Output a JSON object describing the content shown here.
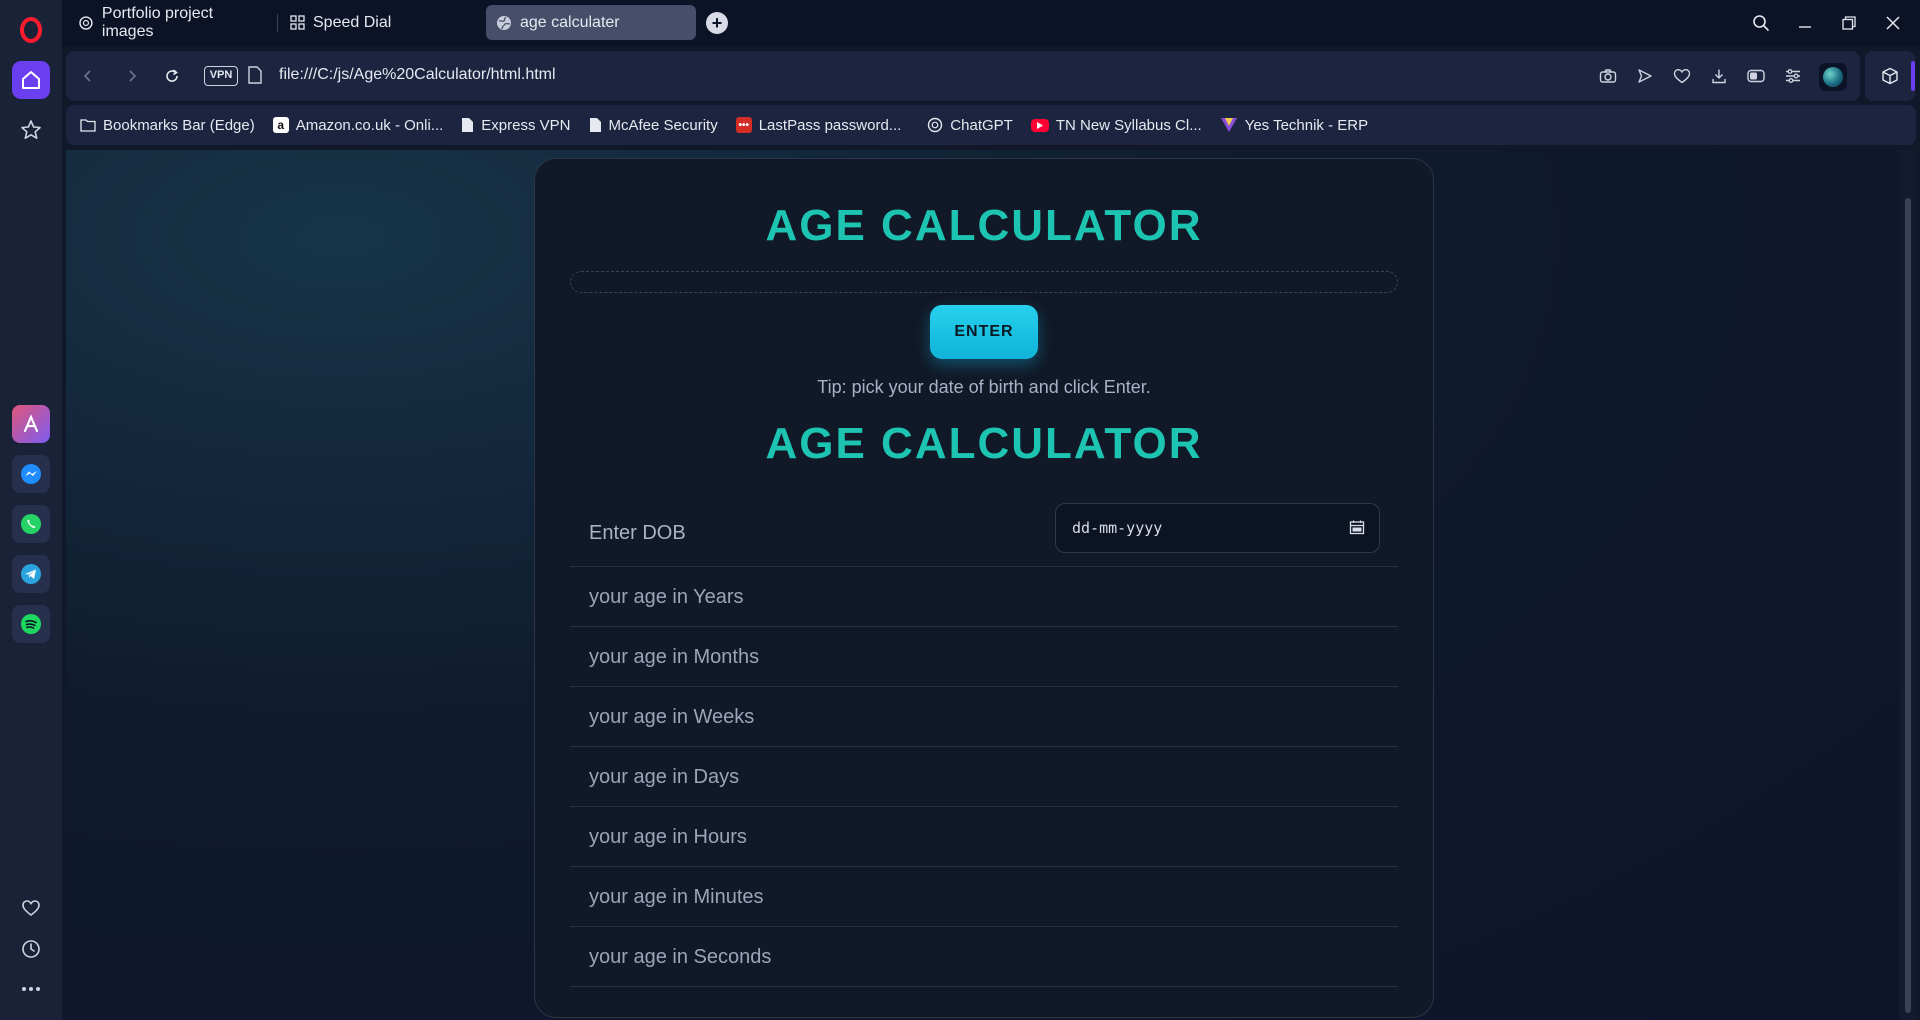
{
  "browser": {
    "tabs": [
      {
        "label": "Portfolio project images",
        "icon": "openai-icon"
      },
      {
        "label": "Speed Dial",
        "icon": "grid-icon"
      },
      {
        "label": "age calculater",
        "icon": "globe-icon",
        "active": true
      }
    ],
    "vpn_label": "VPN",
    "url": "file:///C:/js/Age%20Calculator/html.html",
    "bookmarks": [
      {
        "label": "Bookmarks Bar (Edge)",
        "icon": "folder-icon"
      },
      {
        "label": "Amazon.co.uk - Onli...",
        "icon": "amazon-icon"
      },
      {
        "label": "Express VPN",
        "icon": "page-icon"
      },
      {
        "label": "McAfee Security",
        "icon": "page-icon"
      },
      {
        "label": "LastPass password...",
        "icon": "lastpass-icon"
      },
      {
        "label": "ChatGPT",
        "icon": "openai-icon"
      },
      {
        "label": "TN New Syllabus Cl...",
        "icon": "youtube-icon"
      },
      {
        "label": "Yes Technik - ERP",
        "icon": "yestechnik-icon"
      }
    ]
  },
  "page": {
    "title": "AGE CALCULATOR",
    "enter_button": "ENTER",
    "tip": "Tip: pick your date of birth and click Enter.",
    "subtitle": "AGE CALCULATOR",
    "dob_label": "Enter DOB",
    "dob_placeholder": "dd-mm-yyyy",
    "results": [
      "your age in Years",
      "your age in Months",
      "your age in Weeks",
      "your age in Days",
      "your age in Hours",
      "your age in Minutes",
      "your age in Seconds"
    ]
  },
  "colors": {
    "accent_teal": "#1ec4b2",
    "button_cyan": "#1ec3e4",
    "opera_purple": "#6a3ff0",
    "card_bg": "#111827"
  }
}
